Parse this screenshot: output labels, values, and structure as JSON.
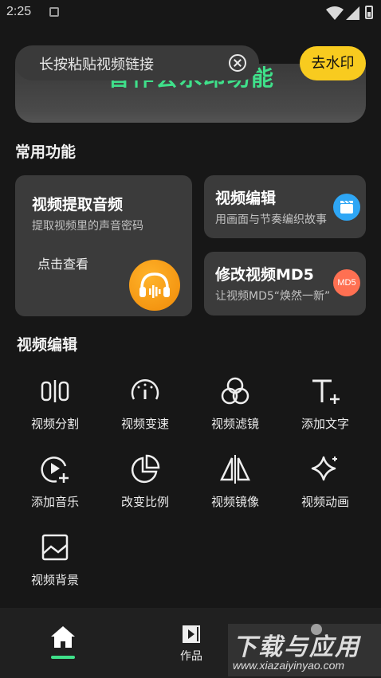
{
  "status": {
    "time": "2:25"
  },
  "banner": {
    "text": "音作会水印功能"
  },
  "search": {
    "placeholder": "长按粘贴视频链接"
  },
  "watermark_button": {
    "label": "去水印"
  },
  "common": {
    "title": "常用功能",
    "extract_audio": {
      "title": "视频提取音频",
      "subtitle": "提取视频里的声音密码",
      "cta": "点击查看"
    },
    "video_edit": {
      "title": "视频编辑",
      "subtitle": "用画面与节奏编织故事"
    },
    "md5": {
      "title": "修改视频MD5",
      "subtitle": "让视频MD5“焕然一新”",
      "badge": "MD5"
    }
  },
  "tools": {
    "title": "视频编辑",
    "items": [
      {
        "label": "视频分割",
        "icon": "split-icon"
      },
      {
        "label": "视频变速",
        "icon": "speedometer-icon"
      },
      {
        "label": "视频滤镜",
        "icon": "filter-icon"
      },
      {
        "label": "添加文字",
        "icon": "text-add-icon"
      },
      {
        "label": "添加音乐",
        "icon": "music-add-icon"
      },
      {
        "label": "改变比例",
        "icon": "pie-ratio-icon"
      },
      {
        "label": "视频镜像",
        "icon": "mirror-icon"
      },
      {
        "label": "视频动画",
        "icon": "sparkle-icon"
      },
      {
        "label": "视频背景",
        "icon": "image-icon"
      }
    ]
  },
  "tabbar": {
    "works_label": "作品",
    "accent": "#3fe08a"
  },
  "logo_watermark": {
    "title": "下载与应用",
    "url": "www.xiazaiyinyao.com"
  },
  "colors": {
    "background": "#171717",
    "card": "#3b3b3b",
    "button": "#f8cb1f"
  }
}
